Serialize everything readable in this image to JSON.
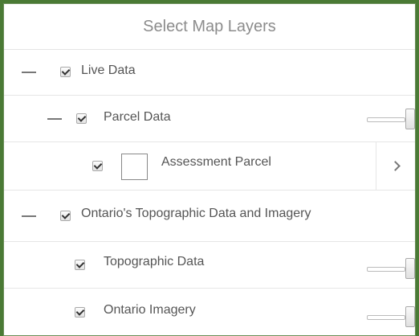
{
  "panel": {
    "title": "Select Map Layers"
  },
  "layers": {
    "live_data": {
      "label": "Live Data",
      "checked": true,
      "expanded": true
    },
    "parcel_data": {
      "label": "Parcel Data",
      "checked": true,
      "expanded": true,
      "opacity": 1.0
    },
    "assessment_parcel": {
      "label": "Assessment Parcel",
      "checked": true
    },
    "ontario_topo": {
      "label": "Ontario's Topographic Data and Imagery",
      "checked": true,
      "expanded": true
    },
    "topographic_data": {
      "label": "Topographic Data",
      "checked": true,
      "opacity": 1.0
    },
    "ontario_imagery": {
      "label": "Ontario Imagery",
      "checked": true,
      "opacity": 1.0
    }
  },
  "icons": {
    "collapse": "minus-icon",
    "checkbox": "checkbox-checked-icon",
    "expand": "chevron-right-icon"
  },
  "colors": {
    "frame": "#4a7a35",
    "title_text": "#8c8c8c"
  }
}
